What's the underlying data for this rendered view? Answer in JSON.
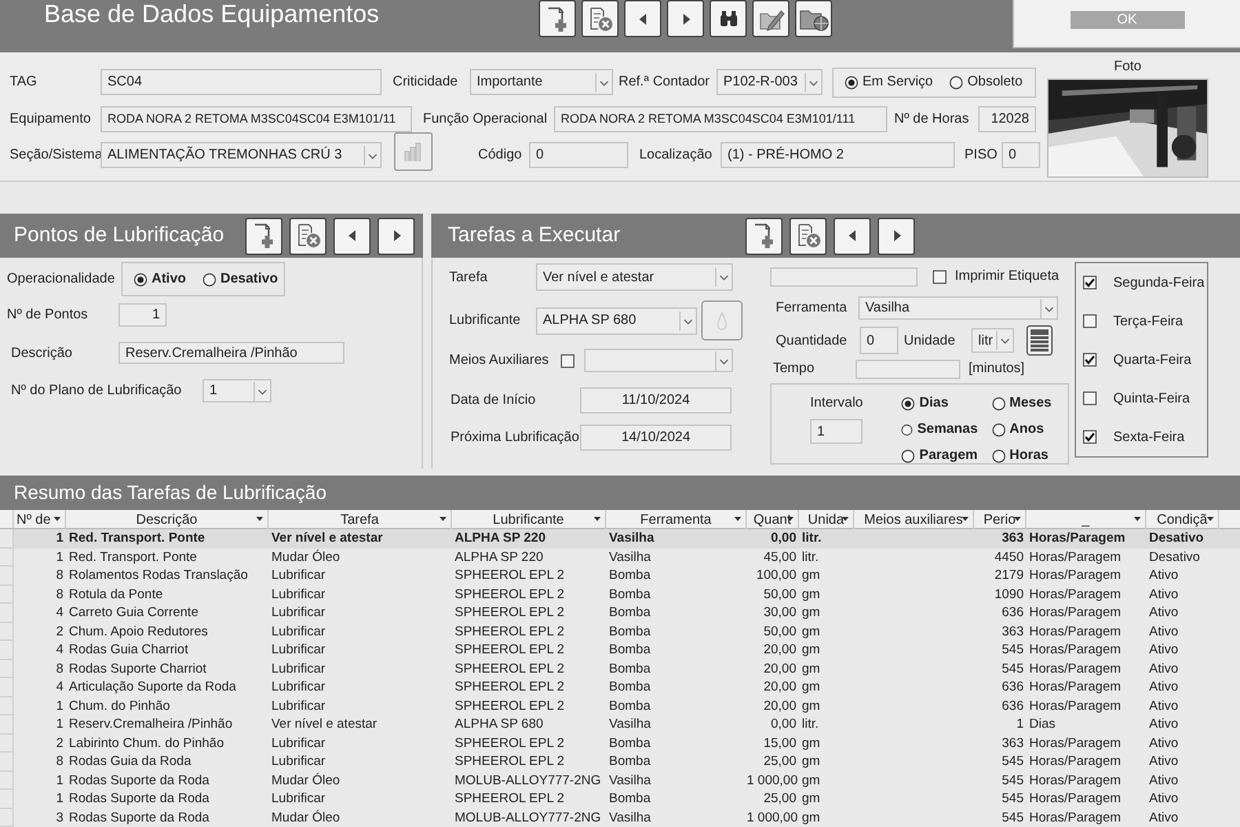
{
  "header": {
    "title": "Base de Dados Equipamentos",
    "toolbar": [
      {
        "kind": "new"
      },
      {
        "kind": "delete"
      },
      {
        "kind": "prev"
      },
      {
        "kind": "next"
      },
      {
        "kind": "find"
      },
      {
        "kind": "edit"
      },
      {
        "kind": "open"
      }
    ]
  },
  "dialog": {
    "button": "OK"
  },
  "equipment": {
    "tag": {
      "label": "TAG",
      "value": "SC04"
    },
    "criticidade": {
      "label": "Criticidade",
      "value": "Importante"
    },
    "ref_contador": {
      "label": "Ref.ª Contador",
      "value": "P102-R-003"
    },
    "estado": [
      {
        "label": "Em Serviço",
        "selected": true
      },
      {
        "label": "Obsoleto",
        "selected": false
      }
    ],
    "equipamento": {
      "label": "Equipamento",
      "value": "RODA NORA 2 RETOMA M3SC04SC04 E3M101/11"
    },
    "funcao": {
      "label": "Função Operacional",
      "value": "RODA NORA 2 RETOMA M3SC04SC04 E3M101/111"
    },
    "horas": {
      "label": "Nº de Horas",
      "value": "12028"
    },
    "secao": {
      "label": "Seção/Sistema",
      "value": "ALIMENTAÇÃO TREMONHAS CRÚ 3"
    },
    "codigo": {
      "label": "Código",
      "value": "0"
    },
    "localizacao": {
      "label": "Localização",
      "value": "(1) - PRÉ-HOMO 2"
    },
    "piso": {
      "label": "PISO",
      "value": "0"
    },
    "foto": {
      "label": "Foto",
      "kind": "picture"
    }
  },
  "pontos": {
    "title": "Pontos de Lubrificação",
    "toolbar": [
      {
        "kind": "new"
      },
      {
        "kind": "delete"
      },
      {
        "kind": "prev"
      },
      {
        "kind": "next"
      }
    ],
    "operacionalidade": {
      "label": "Operacionalidade",
      "options": [
        {
          "label": "Ativo",
          "selected": true
        },
        {
          "label": "Desativo",
          "selected": false
        }
      ]
    },
    "n_pontos": {
      "label": "Nº de Pontos",
      "value": "1"
    },
    "descricao": {
      "label": "Descrição",
      "value": "Reserv.Cremalheira /Pinhão"
    },
    "plano": {
      "label": "Nº do Plano de Lubrificação",
      "value": "1"
    }
  },
  "tarefas": {
    "title": "Tarefas a Executar",
    "toolbar": [
      {
        "kind": "new"
      },
      {
        "kind": "delete"
      },
      {
        "kind": "prev"
      },
      {
        "kind": "next"
      }
    ],
    "tarefa": {
      "label": "Tarefa",
      "value": "Ver nível e atestar"
    },
    "lubrificante": {
      "label": "Lubrificante",
      "value": "ALPHA SP 680"
    },
    "meios": {
      "label": "Meios Auxiliares",
      "checked": false
    },
    "data_inicio": {
      "label": "Data de Início",
      "value": "11/10/2024"
    },
    "proxima": {
      "label": "Próxima Lubrificação",
      "value": "14/10/2024"
    },
    "imprimir": {
      "label": "Imprimir Etiqueta",
      "checked": false
    },
    "ferramenta": {
      "label": "Ferramenta",
      "value": "Vasilha"
    },
    "quantidade": {
      "label": "Quantidade",
      "value": "0"
    },
    "unidade": {
      "label": "Unidade",
      "value": "litr"
    },
    "tempo": {
      "label": "Tempo",
      "suffix": "[minutos]"
    },
    "intervalo": {
      "label": "Intervalo",
      "value": "1",
      "options": [
        {
          "label": "Dias",
          "selected": true
        },
        {
          "label": "Meses",
          "selected": false
        },
        {
          "label": "Semanas",
          "selected": false
        },
        {
          "label": "Anos",
          "selected": false
        },
        {
          "label": "Paragem",
          "selected": false
        },
        {
          "label": "Horas",
          "selected": false
        }
      ]
    },
    "dias": [
      {
        "label": "Segunda-Feira",
        "checked": true
      },
      {
        "label": "Terça-Feira",
        "checked": false
      },
      {
        "label": "Quarta-Feira",
        "checked": true
      },
      {
        "label": "Quinta-Feira",
        "checked": false
      },
      {
        "label": "Sexta-Feira",
        "checked": true
      }
    ]
  },
  "resumo": {
    "title": "Resumo das Tarefas de Lubrificação",
    "columns": [
      "Nº de",
      "Descrição",
      "Tarefa",
      "Lubrificante",
      "Ferramenta",
      "Quant",
      "Unida",
      "Meios auxiliares",
      "Perio",
      "_",
      "Condiçã"
    ],
    "rows": [
      {
        "selected": true,
        "cells": [
          "1",
          "Red. Transport. Ponte",
          "Ver nível e atestar",
          "ALPHA SP 220",
          "Vasilha",
          "0,00",
          "litr.",
          "",
          "363",
          "Horas/Paragem",
          "Desativo"
        ]
      },
      {
        "selected": false,
        "cells": [
          "1",
          "Red. Transport. Ponte",
          "Mudar Óleo",
          "ALPHA SP 220",
          "Vasilha",
          "45,00",
          "litr.",
          "",
          "4450",
          "Horas/Paragem",
          "Desativo"
        ]
      },
      {
        "selected": false,
        "cells": [
          "8",
          "Rolamentos Rodas Translação",
          "Lubrificar",
          "SPHEEROL EPL 2",
          "Bomba",
          "100,00",
          "gm",
          "",
          "2179",
          "Horas/Paragem",
          "Ativo"
        ]
      },
      {
        "selected": false,
        "cells": [
          "8",
          "Rotula da Ponte",
          "Lubrificar",
          "SPHEEROL EPL 2",
          "Bomba",
          "50,00",
          "gm",
          "",
          "1090",
          "Horas/Paragem",
          "Ativo"
        ]
      },
      {
        "selected": false,
        "cells": [
          "4",
          "Carreto Guia Corrente",
          "Lubrificar",
          "SPHEEROL EPL 2",
          "Bomba",
          "30,00",
          "gm",
          "",
          "636",
          "Horas/Paragem",
          "Ativo"
        ]
      },
      {
        "selected": false,
        "cells": [
          "2",
          "Chum. Apoio Redutores",
          "Lubrificar",
          "SPHEEROL EPL 2",
          "Bomba",
          "50,00",
          "gm",
          "",
          "363",
          "Horas/Paragem",
          "Ativo"
        ]
      },
      {
        "selected": false,
        "cells": [
          "4",
          "Rodas Guia Charriot",
          "Lubrificar",
          "SPHEEROL EPL 2",
          "Bomba",
          "20,00",
          "gm",
          "",
          "545",
          "Horas/Paragem",
          "Ativo"
        ]
      },
      {
        "selected": false,
        "cells": [
          "8",
          "Rodas Suporte Charriot",
          "Lubrificar",
          "SPHEEROL EPL 2",
          "Bomba",
          "20,00",
          "gm",
          "",
          "545",
          "Horas/Paragem",
          "Ativo"
        ]
      },
      {
        "selected": false,
        "cells": [
          "4",
          "Articulação Suporte da Roda",
          "Lubrificar",
          "SPHEEROL EPL 2",
          "Bomba",
          "20,00",
          "gm",
          "",
          "636",
          "Horas/Paragem",
          "Ativo"
        ]
      },
      {
        "selected": false,
        "cells": [
          "1",
          "Chum. do Pinhão",
          "Lubrificar",
          "SPHEEROL EPL 2",
          "Bomba",
          "20,00",
          "gm",
          "",
          "636",
          "Horas/Paragem",
          "Ativo"
        ]
      },
      {
        "selected": false,
        "cells": [
          "1",
          "Reserv.Cremalheira /Pinhão",
          "Ver nível e atestar",
          "ALPHA SP 680",
          "Vasilha",
          "0,00",
          "litr.",
          "",
          "1",
          "Dias",
          "Ativo"
        ]
      },
      {
        "selected": false,
        "cells": [
          "2",
          "Labirinto Chum. do Pinhão",
          "Lubrificar",
          "SPHEEROL EPL 2",
          "Bomba",
          "15,00",
          "gm",
          "",
          "363",
          "Horas/Paragem",
          "Ativo"
        ]
      },
      {
        "selected": false,
        "cells": [
          "8",
          "Rodas Guia da Roda",
          "Lubrificar",
          "SPHEEROL EPL 2",
          "Bomba",
          "25,00",
          "gm",
          "",
          "545",
          "Horas/Paragem",
          "Ativo"
        ]
      },
      {
        "selected": false,
        "cells": [
          "1",
          "Rodas Suporte da Roda",
          "Mudar Óleo",
          "MOLUB-ALLOY777-2NG",
          "Vasilha",
          "1 000,00",
          "gm",
          "",
          "545",
          "Horas/Paragem",
          "Ativo"
        ]
      },
      {
        "selected": false,
        "cells": [
          "1",
          "Rodas Suporte da Roda",
          "Lubrificar",
          "SPHEEROL EPL 2",
          "Bomba",
          "25,00",
          "gm",
          "",
          "545",
          "Horas/Paragem",
          "Ativo"
        ]
      },
      {
        "selected": false,
        "cells": [
          "3",
          "Rodas Suporte da Roda",
          "Mudar Óleo",
          "MOLUB-ALLOY777-2NG",
          "Vasilha",
          "1 000,00",
          "gm",
          "",
          "545",
          "Horas/Paragem",
          "Ativo"
        ]
      }
    ]
  }
}
